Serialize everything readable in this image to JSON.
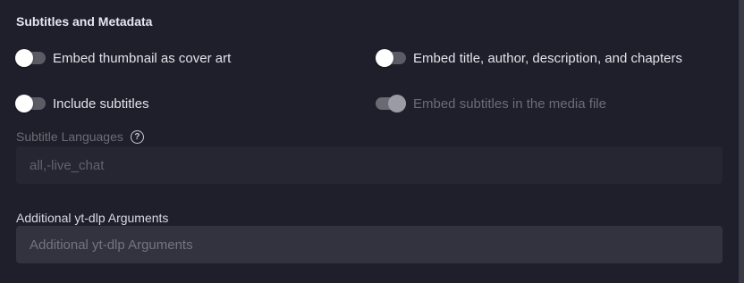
{
  "section": {
    "title": "Subtitles and Metadata"
  },
  "toggles": {
    "embed_thumbnail": {
      "label": "Embed thumbnail as cover art",
      "on": false,
      "disabled": false
    },
    "embed_metadata": {
      "label": "Embed title, author, description, and chapters",
      "on": false,
      "disabled": false
    },
    "include_subtitles": {
      "label": "Include subtitles",
      "on": false,
      "disabled": false
    },
    "embed_subtitles": {
      "label": "Embed subtitles in the media file",
      "on": true,
      "disabled": true
    }
  },
  "subtitle_languages": {
    "label": "Subtitle Languages",
    "value": "all,-live_chat",
    "help_icon": "question-circle-icon"
  },
  "ytdlp_args": {
    "label": "Additional yt-dlp Arguments",
    "placeholder": "Additional yt-dlp Arguments",
    "value": ""
  },
  "colors": {
    "background": "#1f1f2b",
    "toggle_track": "#5b5b66",
    "toggle_thumb": "#ffffff",
    "input_background": "#33333f"
  }
}
